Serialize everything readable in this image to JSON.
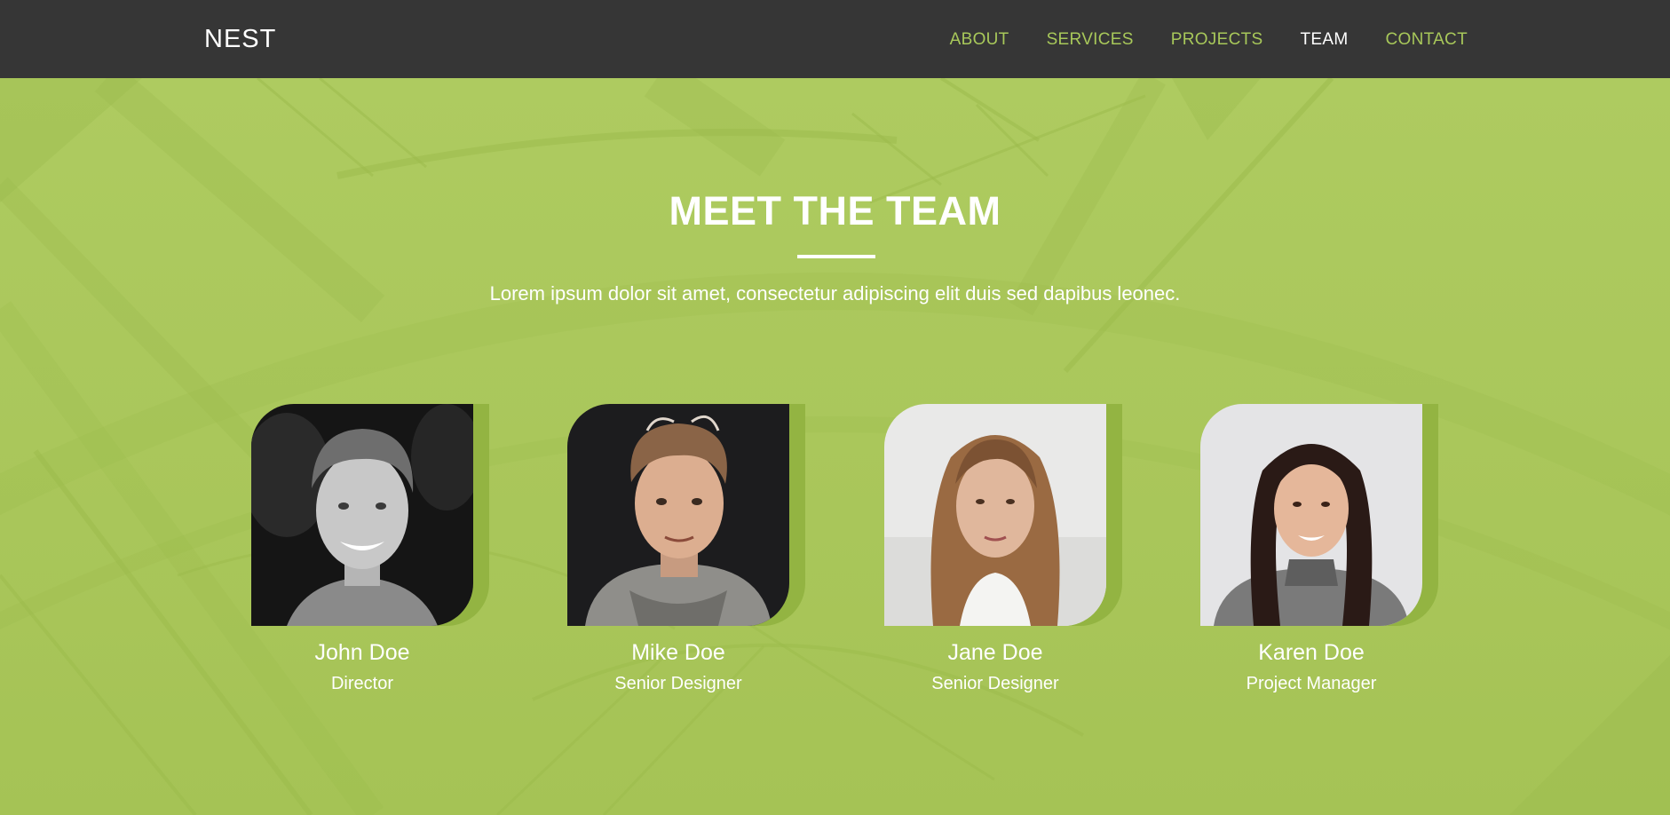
{
  "header": {
    "brand": "NEST",
    "nav": [
      {
        "label": "ABOUT",
        "active": false
      },
      {
        "label": "SERVICES",
        "active": false
      },
      {
        "label": "PROJECTS",
        "active": false
      },
      {
        "label": "TEAM",
        "active": true
      },
      {
        "label": "CONTACT",
        "active": false
      }
    ]
  },
  "section": {
    "title": "MEET THE TEAM",
    "subtitle": "Lorem ipsum dolor sit amet, consectetur adipiscing elit duis sed dapibus leonec."
  },
  "team": [
    {
      "name": "John Doe",
      "role": "Director"
    },
    {
      "name": "Mike Doe",
      "role": "Senior Designer"
    },
    {
      "name": "Jane Doe",
      "role": "Senior Designer"
    },
    {
      "name": "Karen Doe",
      "role": "Project Manager"
    }
  ],
  "colors": {
    "header_bg": "#363636",
    "accent": "#a8c85a",
    "hero_bg": "#aac85c",
    "text_light": "#ffffff"
  }
}
